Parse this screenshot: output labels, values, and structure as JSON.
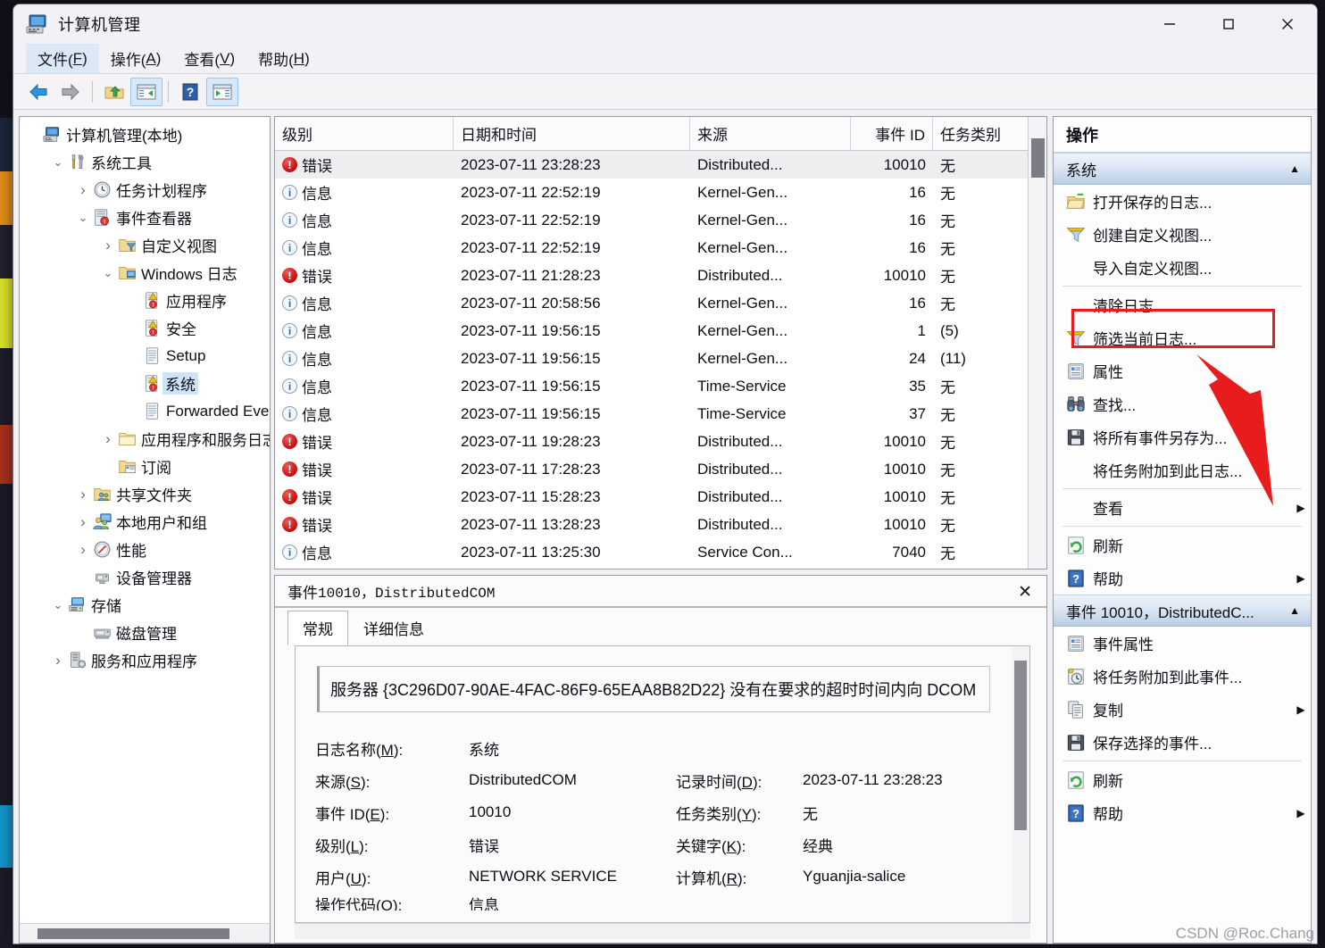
{
  "window": {
    "title": "计算机管理",
    "icon": "computer-management-icon",
    "minimize": "—",
    "maximize": "▢",
    "close": "✕"
  },
  "menubar": [
    {
      "label": "文件(F)",
      "name": "menu-file",
      "active": true
    },
    {
      "label": "操作(A)",
      "name": "menu-action",
      "active": false
    },
    {
      "label": "查看(V)",
      "name": "menu-view",
      "active": false
    },
    {
      "label": "帮助(H)",
      "name": "menu-help",
      "active": false
    }
  ],
  "toolbar": [
    {
      "name": "back-button",
      "icon": "arrow-left-icon",
      "selected": false
    },
    {
      "name": "forward-button",
      "icon": "arrow-right-icon",
      "selected": false
    },
    {
      "name": "up-folder-button",
      "icon": "folder-up-icon",
      "selected": false
    },
    {
      "name": "show-hide-tree-button",
      "icon": "show-tree-icon",
      "selected": true
    },
    {
      "name": "help-button",
      "icon": "question-mark-icon",
      "selected": false
    },
    {
      "name": "show-hide-actions-button",
      "icon": "show-actions-icon",
      "selected": true
    }
  ],
  "tree": {
    "nodes": [
      {
        "label": "计算机管理(本地)",
        "indent": 0,
        "twist": "",
        "icon": "computer-icon",
        "selected": false
      },
      {
        "label": "系统工具",
        "indent": 1,
        "twist": "⌄",
        "icon": "tools-icon",
        "selected": false
      },
      {
        "label": "任务计划程序",
        "indent": 2,
        "twist": "›",
        "icon": "clock-icon",
        "selected": false
      },
      {
        "label": "事件查看器",
        "indent": 2,
        "twist": "⌄",
        "icon": "event-viewer-icon",
        "selected": false
      },
      {
        "label": "自定义视图",
        "indent": 3,
        "twist": "›",
        "icon": "folder-filter-icon",
        "selected": false
      },
      {
        "label": "Windows 日志",
        "indent": 3,
        "twist": "⌄",
        "icon": "folder-windows-icon",
        "selected": false
      },
      {
        "label": "应用程序",
        "indent": 4,
        "twist": "",
        "icon": "log-warning-icon",
        "selected": false
      },
      {
        "label": "安全",
        "indent": 4,
        "twist": "",
        "icon": "log-warning-icon",
        "selected": false
      },
      {
        "label": "Setup",
        "indent": 4,
        "twist": "",
        "icon": "log-plain-icon",
        "selected": false
      },
      {
        "label": "系统",
        "indent": 4,
        "twist": "",
        "icon": "log-warning-icon",
        "selected": true
      },
      {
        "label": "Forwarded Even",
        "indent": 4,
        "twist": "",
        "icon": "log-plain-icon",
        "selected": false
      },
      {
        "label": "应用程序和服务日志",
        "indent": 3,
        "twist": "›",
        "icon": "folder-plain-icon",
        "selected": false
      },
      {
        "label": "订阅",
        "indent": 3,
        "twist": "",
        "icon": "subscription-icon",
        "selected": false
      },
      {
        "label": "共享文件夹",
        "indent": 2,
        "twist": "›",
        "icon": "shared-folder-icon",
        "selected": false
      },
      {
        "label": "本地用户和组",
        "indent": 2,
        "twist": "›",
        "icon": "users-icon",
        "selected": false
      },
      {
        "label": "性能",
        "indent": 2,
        "twist": "›",
        "icon": "performance-icon",
        "selected": false
      },
      {
        "label": "设备管理器",
        "indent": 2,
        "twist": "",
        "icon": "device-manager-icon",
        "selected": false
      },
      {
        "label": "存储",
        "indent": 1,
        "twist": "⌄",
        "icon": "storage-icon",
        "selected": false
      },
      {
        "label": "磁盘管理",
        "indent": 2,
        "twist": "",
        "icon": "disk-management-icon",
        "selected": false
      },
      {
        "label": "服务和应用程序",
        "indent": 1,
        "twist": "›",
        "icon": "services-icon",
        "selected": false
      }
    ]
  },
  "event_list": {
    "columns": [
      "级别",
      "日期和时间",
      "来源",
      "事件 ID",
      "任务类别"
    ],
    "rows": [
      {
        "level": "错误",
        "level_kind": "error",
        "datetime": "2023-07-11 23:28:23",
        "source": "Distributed...",
        "id": "10010",
        "task": "无",
        "selected": true
      },
      {
        "level": "信息",
        "level_kind": "info",
        "datetime": "2023-07-11 22:52:19",
        "source": "Kernel-Gen...",
        "id": "16",
        "task": "无",
        "selected": false
      },
      {
        "level": "信息",
        "level_kind": "info",
        "datetime": "2023-07-11 22:52:19",
        "source": "Kernel-Gen...",
        "id": "16",
        "task": "无",
        "selected": false
      },
      {
        "level": "信息",
        "level_kind": "info",
        "datetime": "2023-07-11 22:52:19",
        "source": "Kernel-Gen...",
        "id": "16",
        "task": "无",
        "selected": false
      },
      {
        "level": "错误",
        "level_kind": "error",
        "datetime": "2023-07-11 21:28:23",
        "source": "Distributed...",
        "id": "10010",
        "task": "无",
        "selected": false
      },
      {
        "level": "信息",
        "level_kind": "info",
        "datetime": "2023-07-11 20:58:56",
        "source": "Kernel-Gen...",
        "id": "16",
        "task": "无",
        "selected": false
      },
      {
        "level": "信息",
        "level_kind": "info",
        "datetime": "2023-07-11 19:56:15",
        "source": "Kernel-Gen...",
        "id": "1",
        "task": "(5)",
        "selected": false
      },
      {
        "level": "信息",
        "level_kind": "info",
        "datetime": "2023-07-11 19:56:15",
        "source": "Kernel-Gen...",
        "id": "24",
        "task": "(11)",
        "selected": false
      },
      {
        "level": "信息",
        "level_kind": "info",
        "datetime": "2023-07-11 19:56:15",
        "source": "Time-Service",
        "id": "35",
        "task": "无",
        "selected": false
      },
      {
        "level": "信息",
        "level_kind": "info",
        "datetime": "2023-07-11 19:56:15",
        "source": "Time-Service",
        "id": "37",
        "task": "无",
        "selected": false
      },
      {
        "level": "错误",
        "level_kind": "error",
        "datetime": "2023-07-11 19:28:23",
        "source": "Distributed...",
        "id": "10010",
        "task": "无",
        "selected": false
      },
      {
        "level": "错误",
        "level_kind": "error",
        "datetime": "2023-07-11 17:28:23",
        "source": "Distributed...",
        "id": "10010",
        "task": "无",
        "selected": false
      },
      {
        "level": "错误",
        "level_kind": "error",
        "datetime": "2023-07-11 15:28:23",
        "source": "Distributed...",
        "id": "10010",
        "task": "无",
        "selected": false
      },
      {
        "level": "错误",
        "level_kind": "error",
        "datetime": "2023-07-11 13:28:23",
        "source": "Distributed...",
        "id": "10010",
        "task": "无",
        "selected": false
      },
      {
        "level": "信息",
        "level_kind": "info",
        "datetime": "2023-07-11 13:25:30",
        "source": "Service Con...",
        "id": "7040",
        "task": "无",
        "selected": false
      }
    ]
  },
  "detail": {
    "title_prefix": "事件 ",
    "title_id": "10010，DistributedCOM",
    "close_label": "✕",
    "tabs": [
      {
        "label": "常规",
        "active": true
      },
      {
        "label": "详细信息",
        "active": false
      }
    ],
    "message": "服务器 {3C296D07-90AE-4FAC-86F9-65EAA8B82D22} 没有在要求的超时时间内向 DCOM",
    "fields": [
      {
        "label": "日志名称(M):",
        "value": "系统",
        "label2": "",
        "value2": ""
      },
      {
        "label": "来源(S):",
        "value": "DistributedCOM",
        "label2": "记录时间(D):",
        "value2": "2023-07-11 23:28:23"
      },
      {
        "label": "事件 ID(E):",
        "value": "10010",
        "label2": "任务类别(Y):",
        "value2": "无"
      },
      {
        "label": "级别(L):",
        "value": "错误",
        "label2": "关键字(K):",
        "value2": "经典"
      },
      {
        "label": "用户(U):",
        "value": "NETWORK SERVICE",
        "label2": "计算机(R):",
        "value2": "Yguanjia-salice"
      },
      {
        "label": "操作代码(O):",
        "value": "信息",
        "label2": "",
        "value2": ""
      }
    ]
  },
  "actions": {
    "title": "操作",
    "groups": [
      {
        "header": "系统",
        "collapse_icon": "▲",
        "items": [
          {
            "label": "打开保存的日志...",
            "icon": "open-log-icon",
            "chevron": "",
            "sep_after": false,
            "highlighted": false
          },
          {
            "label": "创建自定义视图...",
            "icon": "filter-icon",
            "chevron": "",
            "sep_after": false,
            "highlighted": false
          },
          {
            "label": "导入自定义视图...",
            "icon": "",
            "chevron": "",
            "sep_after": true,
            "highlighted": false
          },
          {
            "label": "清除日志...",
            "icon": "",
            "chevron": "",
            "sep_after": false,
            "highlighted": false
          },
          {
            "label": "筛选当前日志...",
            "icon": "filter-icon",
            "chevron": "",
            "sep_after": false,
            "highlighted": true
          },
          {
            "label": "属性",
            "icon": "properties-icon",
            "chevron": "",
            "sep_after": false,
            "highlighted": false
          },
          {
            "label": "查找...",
            "icon": "binoculars-icon",
            "chevron": "",
            "sep_after": false,
            "highlighted": false
          },
          {
            "label": "将所有事件另存为...",
            "icon": "save-icon",
            "chevron": "",
            "sep_after": false,
            "highlighted": false
          },
          {
            "label": "将任务附加到此日志...",
            "icon": "",
            "chevron": "",
            "sep_after": true,
            "highlighted": false
          },
          {
            "label": "查看",
            "icon": "",
            "chevron": "▶",
            "sep_after": true,
            "highlighted": false
          },
          {
            "label": "刷新",
            "icon": "refresh-icon",
            "chevron": "",
            "sep_after": false,
            "highlighted": false
          },
          {
            "label": "帮助",
            "icon": "help-icon",
            "chevron": "▶",
            "sep_after": false,
            "highlighted": false
          }
        ]
      },
      {
        "header": "事件 10010，DistributedC...",
        "collapse_icon": "▲",
        "items": [
          {
            "label": "事件属性",
            "icon": "properties-icon",
            "chevron": "",
            "sep_after": false,
            "highlighted": false
          },
          {
            "label": "将任务附加到此事件...",
            "icon": "attach-task-icon",
            "chevron": "",
            "sep_after": false,
            "highlighted": false
          },
          {
            "label": "复制",
            "icon": "copy-icon",
            "chevron": "▶",
            "sep_after": false,
            "highlighted": false
          },
          {
            "label": "保存选择的事件...",
            "icon": "save-icon",
            "chevron": "",
            "sep_after": true,
            "highlighted": false
          },
          {
            "label": "刷新",
            "icon": "refresh-icon",
            "chevron": "",
            "sep_after": false,
            "highlighted": false
          },
          {
            "label": "帮助",
            "icon": "help-icon",
            "chevron": "▶",
            "sep_after": false,
            "highlighted": false
          }
        ]
      }
    ]
  },
  "annotation": {
    "highlight_color": "#e81c1c",
    "arrow_color": "#e81c1c"
  },
  "watermark": "CSDN @Roc.Chang"
}
